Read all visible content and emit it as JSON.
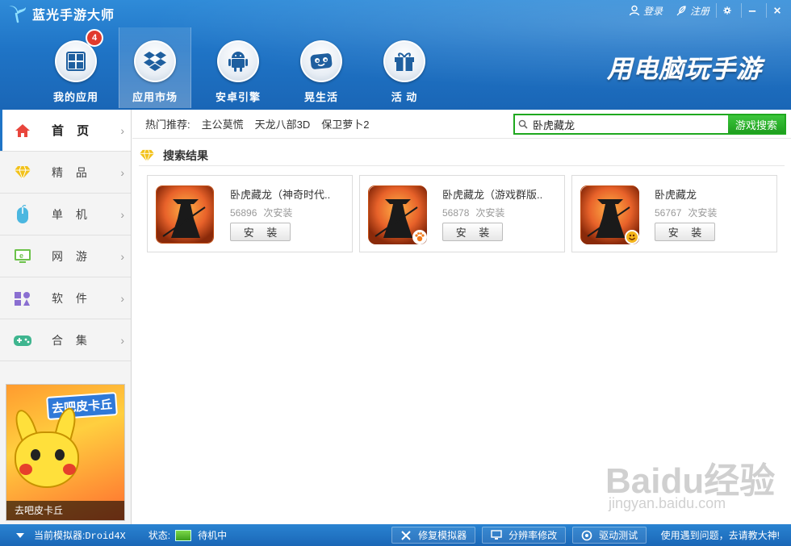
{
  "app": {
    "title": "蓝光手游大师"
  },
  "topbar": {
    "login": "登录",
    "register": "注册"
  },
  "nav": {
    "items": [
      {
        "label": "我的应用",
        "badge": "4",
        "icon": "grid-icon"
      },
      {
        "label": "应用市场",
        "icon": "dropbox-box-icon",
        "active": true
      },
      {
        "label": "安卓引擎",
        "icon": "android-icon"
      },
      {
        "label": "晃生活",
        "icon": "game-face-icon"
      },
      {
        "label": "活 动",
        "icon": "gift-icon"
      }
    ]
  },
  "slogan": "用电脑玩手游",
  "sidebar": {
    "items": [
      {
        "label": "首 页",
        "icon": "home-icon",
        "active": true
      },
      {
        "label": "精 品",
        "icon": "diamond-icon"
      },
      {
        "label": "单 机",
        "icon": "mouse-icon"
      },
      {
        "label": "网 游",
        "icon": "monitor-icon"
      },
      {
        "label": "软 件",
        "icon": "apps-icon"
      },
      {
        "label": "合 集",
        "icon": "gamepad-icon"
      }
    ],
    "promo": {
      "caption": "去吧皮卡丘",
      "title": "去吧皮卡丘"
    }
  },
  "hot": {
    "label": "热门推荐:",
    "links": [
      "主公莫慌",
      "天龙八部3D",
      "保卫萝卜2"
    ]
  },
  "search": {
    "value": "卧虎藏龙",
    "button": "游戏搜索"
  },
  "results": {
    "title": "搜索结果",
    "items": [
      {
        "name": "卧虎藏龙（神奇时代..",
        "count": "56896",
        "unit": "次安装",
        "button": "安 装",
        "badge": ""
      },
      {
        "name": "卧虎藏龙（游戏群版..",
        "count": "56878",
        "unit": "次安装",
        "button": "安 装",
        "badge": "paw-badge-icon"
      },
      {
        "name": "卧虎藏龙",
        "count": "56767",
        "unit": "次安装",
        "button": "安 装",
        "badge": "smile-badge-icon"
      }
    ]
  },
  "watermark": {
    "text": "Baidu经验",
    "sub": "jingyan.baidu.com"
  },
  "status": {
    "emulator_label": "当前模拟器:",
    "emulator_name": "Droid4X",
    "state_label": "状态:",
    "state_value": "待机中",
    "repair": "修复模拟器",
    "resolution": "分辨率修改",
    "driver": "驱动测试",
    "help": "使用遇到问题，去请教大神!"
  },
  "colors": {
    "header": "#1f74c6",
    "accent_green": "#1fa81f",
    "badge_red": "#e13a2d"
  }
}
